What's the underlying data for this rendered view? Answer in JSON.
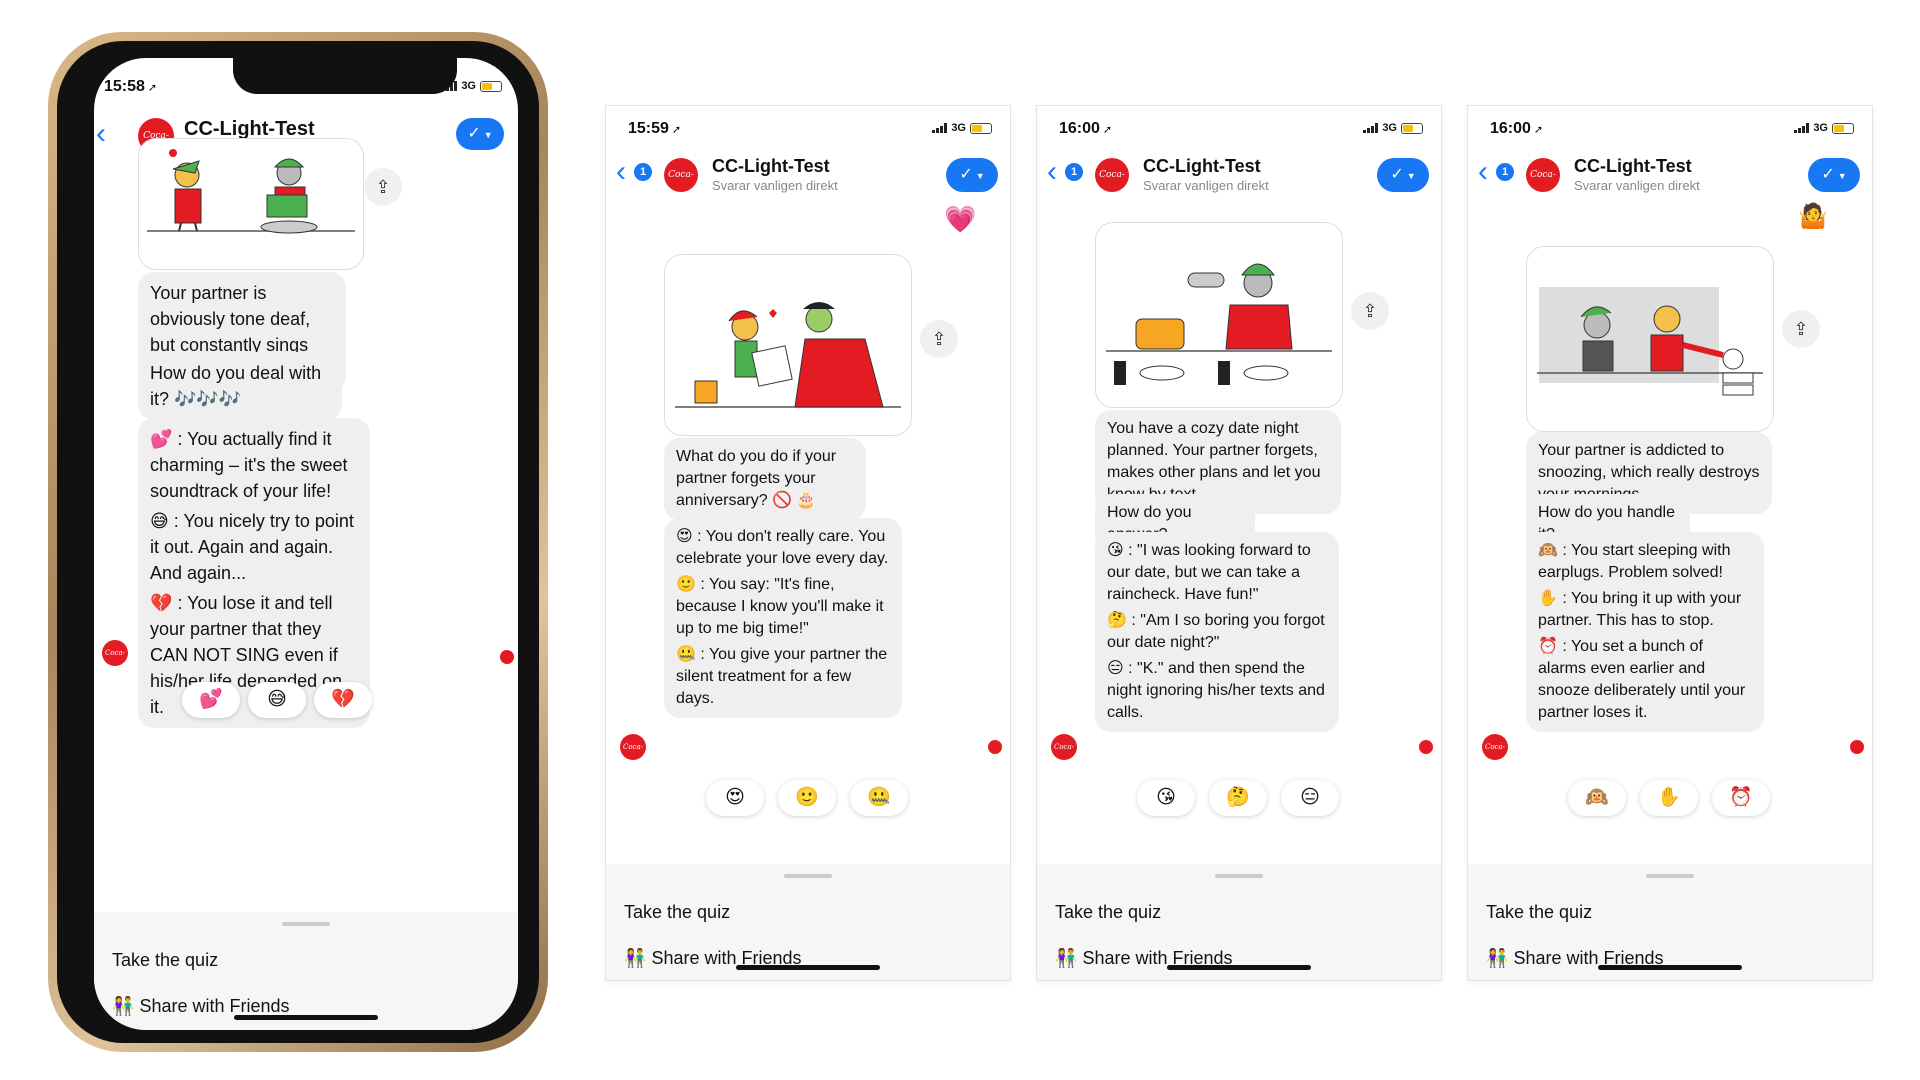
{
  "app": {
    "name": "CC-Light-Test",
    "subtitle": "Svarar vanligen direkt",
    "back_badge": "1",
    "logo_text": "Coca-Cola",
    "menu": {
      "quiz": "Take the quiz",
      "friends": "Share with Friends",
      "friends_icon": "👫"
    }
  },
  "screens": [
    {
      "time": "15:58",
      "network": "3G",
      "bubbles": [
        "Your partner is obviously tone deaf, but constantly sings around the house.",
        "How do you deal with it? 🎶🎶🎶"
      ],
      "answers": [
        "💕 : You actually find it charming – it's the sweet soundtrack of your life!",
        "😅 : You nicely try to point it out. Again and again. And again...",
        "💔 : You lose it and tell your partner that they CAN NOT SING even if his/her life depended on it."
      ],
      "quick_replies": [
        "💕",
        "😅",
        "💔"
      ]
    },
    {
      "time": "15:59",
      "network": "3G",
      "top_emoji": "💗",
      "bubbles": [
        "What do you do if your partner forgets your anniversary? 🚫 🎂"
      ],
      "answers": [
        "😍 : You don't really care. You celebrate your love every day.",
        "🙂 : You say: \"It's fine, because I know you'll make it up to me big time!\"",
        "🤐 : You give your partner the silent treatment for a few days."
      ],
      "quick_replies": [
        "😍",
        "🙂",
        "🤐"
      ]
    },
    {
      "time": "16:00",
      "network": "3G",
      "bubbles": [
        "You have a cozy date night planned. Your partner forgets, makes other plans and let you know by text.",
        "How do you answer?"
      ],
      "answers": [
        "😘 : \"I was looking forward to our date, but we can take a raincheck. Have fun!\"",
        "🤔 : \"Am I so boring you forgot our date night?\"",
        "😑 : \"K.\" and then spend the night ignoring his/her texts and calls."
      ],
      "quick_replies": [
        "😘",
        "🤔",
        "😑"
      ]
    },
    {
      "time": "16:00",
      "network": "3G",
      "top_emoji": "🤷",
      "bubbles": [
        "Your partner is addicted to snoozing, which really destroys your mornings.",
        "How do you handle it?"
      ],
      "answers": [
        "🙉 : You start sleeping with earplugs. Problem solved!",
        "✋ : You bring it up with your partner. This has to stop.",
        "⏰ : You set a bunch of alarms even earlier and snooze deliberately until your partner loses it."
      ],
      "quick_replies": [
        "🙉",
        "✋",
        "⏰"
      ]
    }
  ]
}
